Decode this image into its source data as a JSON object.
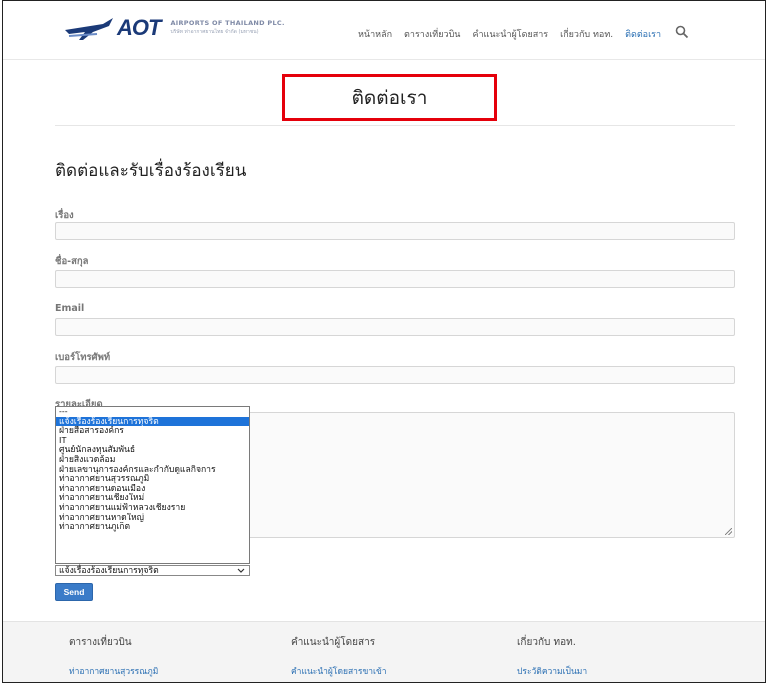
{
  "header": {
    "logo_text": "AOT",
    "logo_sub1": "AIRPORTS OF THAILAND PLC.",
    "logo_sub2": "บริษัท ท่าอากาศยานไทย จำกัด (มหาชน)",
    "nav": [
      "หน้าหลัก",
      "ตารางเที่ยวบิน",
      "คำแนะนำผู้โดยสาร",
      "เกี่ยวกับ ทอท.",
      "ติดต่อเรา"
    ],
    "active_nav": "ติดต่อเรา"
  },
  "page_title": "ติดต่อเรา",
  "section_title": "ติดต่อและรับเรื่องร้องเรียน",
  "form": {
    "subject_label": "เรื่อง",
    "name_label": "ชื่อ-สกุล",
    "email_label": "Email",
    "phone_label": "เบอร์โทรศัพท์",
    "detail_label": "รายละเอียด",
    "subject_value": "",
    "name_value": "",
    "email_value": "",
    "phone_value": "",
    "selected_option": "แจ้งเรื่องร้องเรียนการทุจริต",
    "options": [
      "---",
      "แจ้งเรื่องร้องเรียนการทุจริต",
      "ฝ่ายสื่อสารองค์กร",
      "IT",
      "ศูนย์นักลงทุนสัมพันธ์",
      "ฝ่ายสิ่งแวดล้อม",
      "ฝ่ายเลขานุการองค์กรและกำกับดูแลกิจการ",
      "ท่าอากาศยานสุวรรณภูมิ",
      "ท่าอากาศยานดอนเมือง",
      "ท่าอากาศยานเชียงใหม่",
      "ท่าอากาศยานแม่ฟ้าหลวงเชียงราย",
      "ท่าอากาศยานหาดใหญ่",
      "ท่าอากาศยานภูเก็ต"
    ],
    "send_label": "Send"
  },
  "footer": {
    "col1_heading": "ตารางเที่ยวบิน",
    "col1_link": "ท่าอากาศยานสุวรรณภูมิ",
    "col2_heading": "คำแนะนำผู้โดยสาร",
    "col2_link": "คำแนะนำผู้โดยสารขาเข้า",
    "col3_heading": "เกี่ยวกับ ทอท.",
    "col3_link": "ประวัติความเป็นมา"
  },
  "colors": {
    "brand": "#1b3a78",
    "link": "#2a6fb3",
    "highlight_box": "#e5000b",
    "selected_option_bg": "#1e73d9",
    "send_button": "#3a7bc8"
  }
}
